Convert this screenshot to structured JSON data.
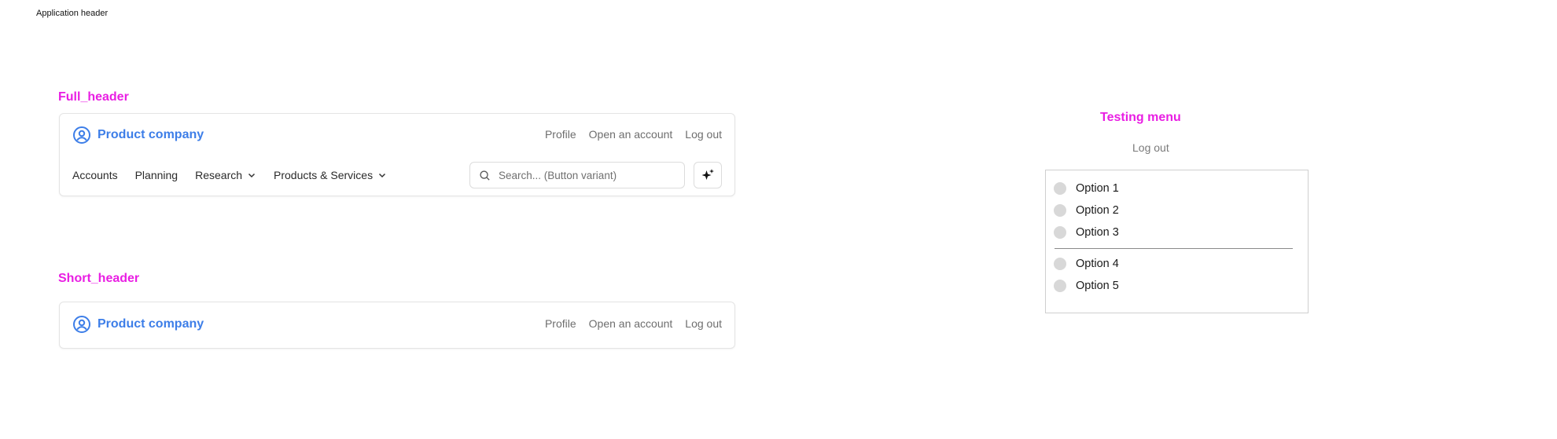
{
  "page": {
    "label": "Application header"
  },
  "full_header": {
    "section_label": "Full_header",
    "brand": {
      "icon": "user-circle-icon",
      "name": "Product company"
    },
    "top_links": [
      "Profile",
      "Open an account",
      "Log out"
    ],
    "nav": [
      {
        "label": "Accounts",
        "has_dropdown": false
      },
      {
        "label": "Planning",
        "has_dropdown": false
      },
      {
        "label": "Research",
        "has_dropdown": true
      },
      {
        "label": "Products & Services",
        "has_dropdown": true
      }
    ],
    "search": {
      "placeholder": "Search... (Button variant)",
      "icon": "search-icon"
    },
    "ai_button": {
      "icon": "sparkle-icon"
    }
  },
  "short_header": {
    "section_label": "Short_header",
    "brand": {
      "icon": "user-circle-icon",
      "name": "Product company"
    },
    "top_links": [
      "Profile",
      "Open an account",
      "Log out"
    ]
  },
  "testing_menu": {
    "title": "Testing menu",
    "logout": "Log out",
    "options": [
      "Option 1",
      "Option 2",
      "Option 3",
      "Option 4",
      "Option 5"
    ]
  },
  "colors": {
    "accent_blue": "#3d7ee8",
    "annotation_magenta": "#e91ee3",
    "border": "#e4e4e4",
    "muted_text": "#6e6e6e"
  }
}
